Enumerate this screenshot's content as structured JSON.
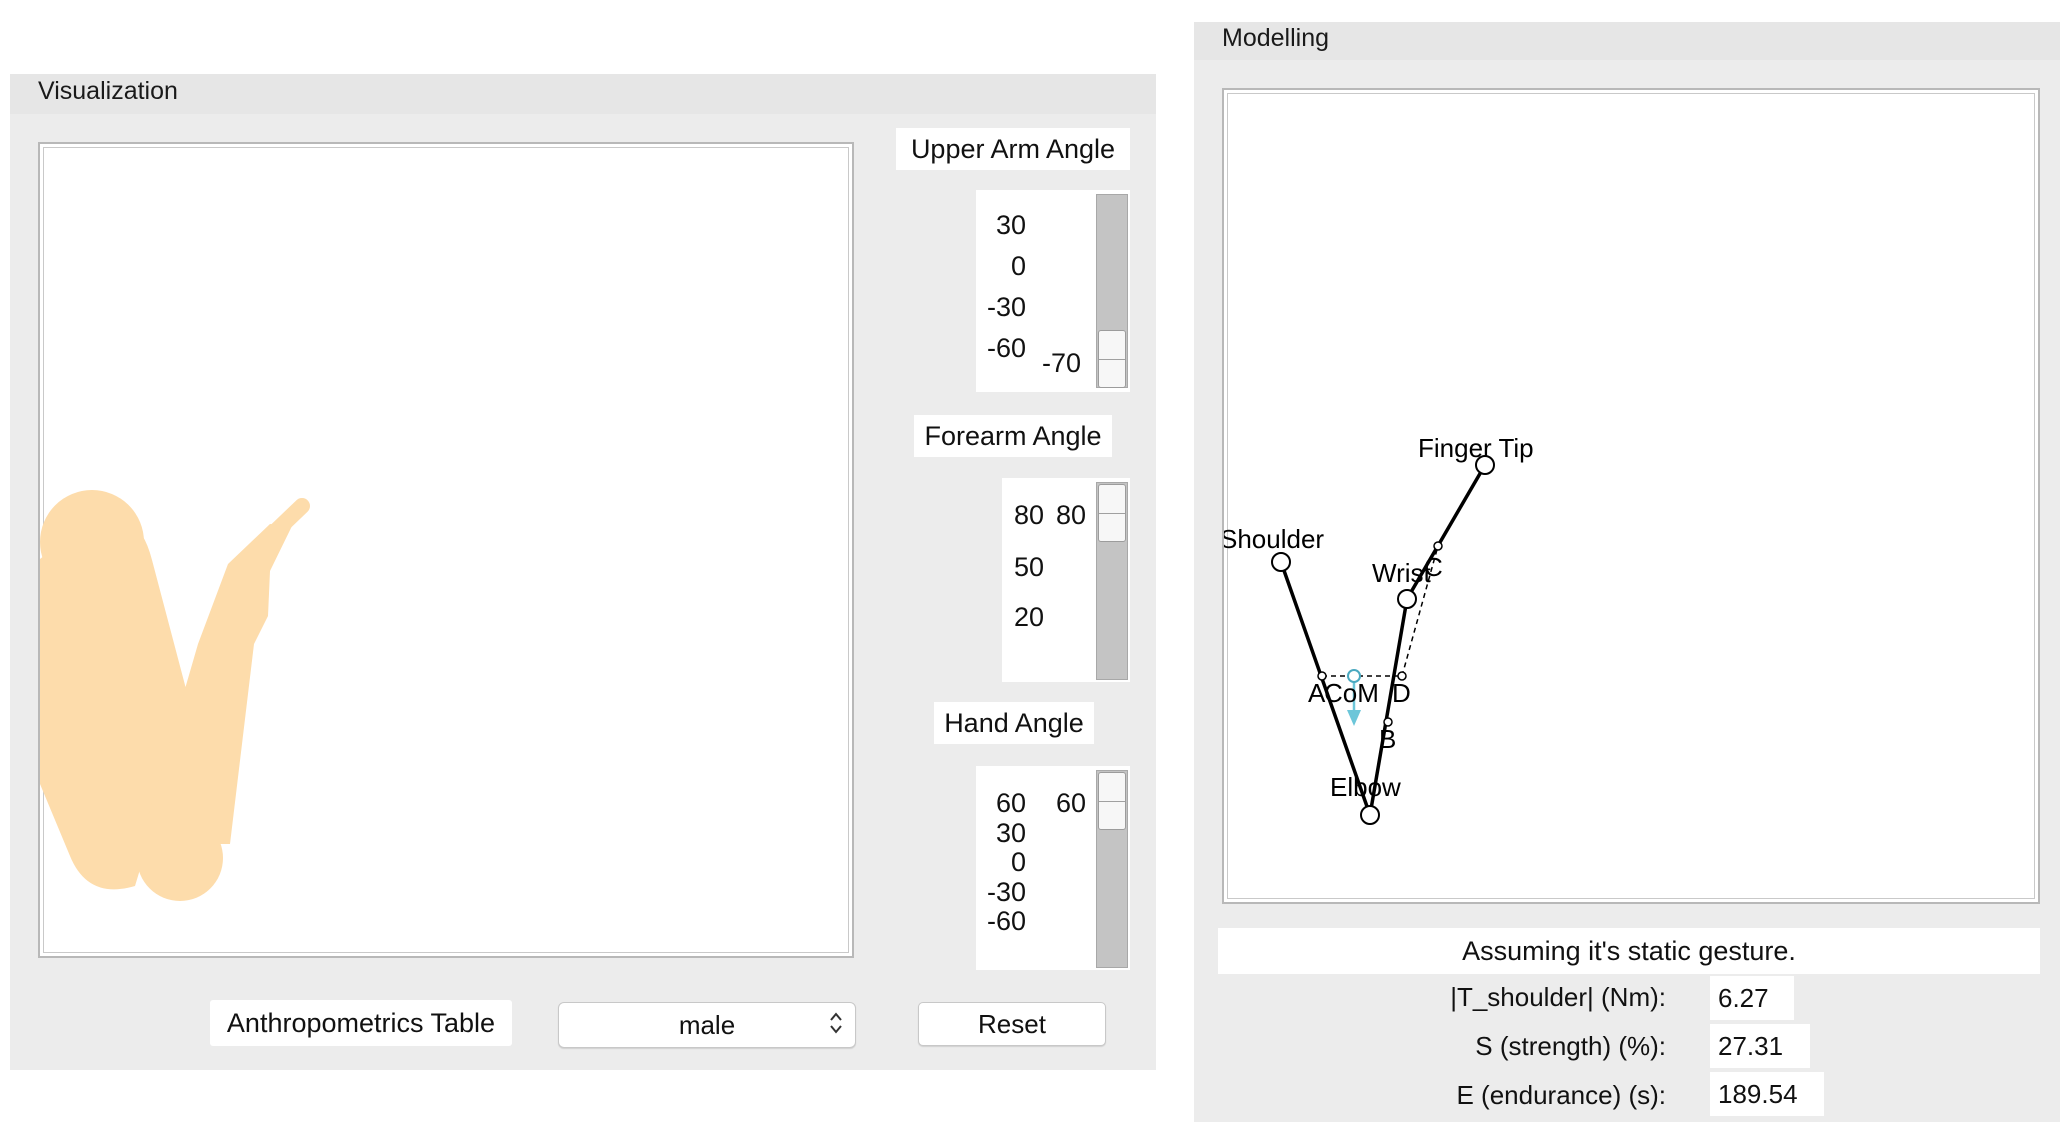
{
  "visualization": {
    "title": "Visualization",
    "sliders": [
      {
        "label": "Upper Arm Angle",
        "ticks": [
          "30",
          "0",
          "-30",
          "-60"
        ],
        "value": "-70"
      },
      {
        "label": "Forearm Angle",
        "ticks": [
          "80",
          "50",
          "20"
        ],
        "value": "80"
      },
      {
        "label": "Hand Angle",
        "ticks": [
          "60",
          "30",
          "0",
          "-30",
          "-60"
        ],
        "value": "60"
      }
    ],
    "anthropometrics_label": "Anthropometrics Table",
    "gender_select": "male",
    "reset_label": "Reset",
    "arm_color": "#fddcab"
  },
  "modelling": {
    "title": "Modelling",
    "points": {
      "finger_tip": "Finger Tip",
      "shoulder": "Shoulder",
      "wrist": "Wrist",
      "c": "C",
      "a": "A",
      "com": "CoM",
      "d": "D",
      "b": "B",
      "elbow": "Elbow"
    },
    "force_arrow_color": "#6cc6d9",
    "assumption": "Assuming it's static gesture.",
    "results": [
      {
        "label": "|T_shoulder| (Nm):",
        "value": "6.27"
      },
      {
        "label": "S (strength) (%):",
        "value": "27.31"
      },
      {
        "label": "E (endurance) (s):",
        "value": "189.54"
      }
    ]
  }
}
